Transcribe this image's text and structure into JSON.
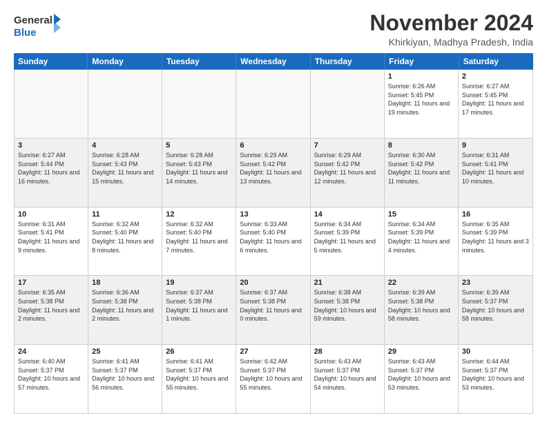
{
  "logo": {
    "general": "General",
    "blue": "Blue"
  },
  "title": "November 2024",
  "location": "Khirkiyan, Madhya Pradesh, India",
  "days_of_week": [
    "Sunday",
    "Monday",
    "Tuesday",
    "Wednesday",
    "Thursday",
    "Friday",
    "Saturday"
  ],
  "weeks": [
    [
      {
        "day": "",
        "info": "",
        "empty": true
      },
      {
        "day": "",
        "info": "",
        "empty": true
      },
      {
        "day": "",
        "info": "",
        "empty": true
      },
      {
        "day": "",
        "info": "",
        "empty": true
      },
      {
        "day": "",
        "info": "",
        "empty": true
      },
      {
        "day": "1",
        "info": "Sunrise: 6:26 AM\nSunset: 5:45 PM\nDaylight: 11 hours and 19 minutes.",
        "empty": false
      },
      {
        "day": "2",
        "info": "Sunrise: 6:27 AM\nSunset: 5:45 PM\nDaylight: 11 hours and 17 minutes.",
        "empty": false
      }
    ],
    [
      {
        "day": "3",
        "info": "Sunrise: 6:27 AM\nSunset: 5:44 PM\nDaylight: 11 hours and 16 minutes.",
        "empty": false
      },
      {
        "day": "4",
        "info": "Sunrise: 6:28 AM\nSunset: 5:43 PM\nDaylight: 11 hours and 15 minutes.",
        "empty": false
      },
      {
        "day": "5",
        "info": "Sunrise: 6:28 AM\nSunset: 5:43 PM\nDaylight: 11 hours and 14 minutes.",
        "empty": false
      },
      {
        "day": "6",
        "info": "Sunrise: 6:29 AM\nSunset: 5:42 PM\nDaylight: 11 hours and 13 minutes.",
        "empty": false
      },
      {
        "day": "7",
        "info": "Sunrise: 6:29 AM\nSunset: 5:42 PM\nDaylight: 11 hours and 12 minutes.",
        "empty": false
      },
      {
        "day": "8",
        "info": "Sunrise: 6:30 AM\nSunset: 5:42 PM\nDaylight: 11 hours and 11 minutes.",
        "empty": false
      },
      {
        "day": "9",
        "info": "Sunrise: 6:31 AM\nSunset: 5:41 PM\nDaylight: 11 hours and 10 minutes.",
        "empty": false
      }
    ],
    [
      {
        "day": "10",
        "info": "Sunrise: 6:31 AM\nSunset: 5:41 PM\nDaylight: 11 hours and 9 minutes.",
        "empty": false
      },
      {
        "day": "11",
        "info": "Sunrise: 6:32 AM\nSunset: 5:40 PM\nDaylight: 11 hours and 8 minutes.",
        "empty": false
      },
      {
        "day": "12",
        "info": "Sunrise: 6:32 AM\nSunset: 5:40 PM\nDaylight: 11 hours and 7 minutes.",
        "empty": false
      },
      {
        "day": "13",
        "info": "Sunrise: 6:33 AM\nSunset: 5:40 PM\nDaylight: 11 hours and 6 minutes.",
        "empty": false
      },
      {
        "day": "14",
        "info": "Sunrise: 6:34 AM\nSunset: 5:39 PM\nDaylight: 11 hours and 5 minutes.",
        "empty": false
      },
      {
        "day": "15",
        "info": "Sunrise: 6:34 AM\nSunset: 5:39 PM\nDaylight: 11 hours and 4 minutes.",
        "empty": false
      },
      {
        "day": "16",
        "info": "Sunrise: 6:35 AM\nSunset: 5:39 PM\nDaylight: 11 hours and 3 minutes.",
        "empty": false
      }
    ],
    [
      {
        "day": "17",
        "info": "Sunrise: 6:35 AM\nSunset: 5:38 PM\nDaylight: 11 hours and 2 minutes.",
        "empty": false
      },
      {
        "day": "18",
        "info": "Sunrise: 6:36 AM\nSunset: 5:38 PM\nDaylight: 11 hours and 2 minutes.",
        "empty": false
      },
      {
        "day": "19",
        "info": "Sunrise: 6:37 AM\nSunset: 5:38 PM\nDaylight: 11 hours and 1 minute.",
        "empty": false
      },
      {
        "day": "20",
        "info": "Sunrise: 6:37 AM\nSunset: 5:38 PM\nDaylight: 11 hours and 0 minutes.",
        "empty": false
      },
      {
        "day": "21",
        "info": "Sunrise: 6:38 AM\nSunset: 5:38 PM\nDaylight: 10 hours and 59 minutes.",
        "empty": false
      },
      {
        "day": "22",
        "info": "Sunrise: 6:39 AM\nSunset: 5:38 PM\nDaylight: 10 hours and 58 minutes.",
        "empty": false
      },
      {
        "day": "23",
        "info": "Sunrise: 6:39 AM\nSunset: 5:37 PM\nDaylight: 10 hours and 58 minutes.",
        "empty": false
      }
    ],
    [
      {
        "day": "24",
        "info": "Sunrise: 6:40 AM\nSunset: 5:37 PM\nDaylight: 10 hours and 57 minutes.",
        "empty": false
      },
      {
        "day": "25",
        "info": "Sunrise: 6:41 AM\nSunset: 5:37 PM\nDaylight: 10 hours and 56 minutes.",
        "empty": false
      },
      {
        "day": "26",
        "info": "Sunrise: 6:41 AM\nSunset: 5:37 PM\nDaylight: 10 hours and 55 minutes.",
        "empty": false
      },
      {
        "day": "27",
        "info": "Sunrise: 6:42 AM\nSunset: 5:37 PM\nDaylight: 10 hours and 55 minutes.",
        "empty": false
      },
      {
        "day": "28",
        "info": "Sunrise: 6:43 AM\nSunset: 5:37 PM\nDaylight: 10 hours and 54 minutes.",
        "empty": false
      },
      {
        "day": "29",
        "info": "Sunrise: 6:43 AM\nSunset: 5:37 PM\nDaylight: 10 hours and 53 minutes.",
        "empty": false
      },
      {
        "day": "30",
        "info": "Sunrise: 6:44 AM\nSunset: 5:37 PM\nDaylight: 10 hours and 53 minutes.",
        "empty": false
      }
    ]
  ]
}
